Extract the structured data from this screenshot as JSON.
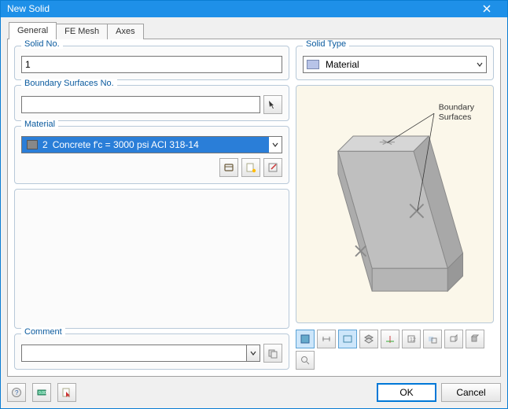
{
  "titlebar": {
    "title": "New Solid"
  },
  "tabs": {
    "general": "General",
    "femesh": "FE Mesh",
    "axes": "Axes",
    "active": "general"
  },
  "solidNo": {
    "label": "Solid No.",
    "value": "1"
  },
  "boundary": {
    "label": "Boundary Surfaces No.",
    "value": ""
  },
  "material": {
    "label": "Material",
    "index": "2",
    "text": "Concrete f'c = 3000 psi    ACI 318-14"
  },
  "comment": {
    "label": "Comment",
    "value": ""
  },
  "solidType": {
    "label": "Solid Type",
    "value": "Material"
  },
  "preview": {
    "annotation": "Boundary\nSurfaces"
  },
  "buttons": {
    "ok": "OK",
    "cancel": "Cancel"
  },
  "icons": {
    "boundary_picker": "pick-surfaces-icon",
    "mat_lib": "material-library-icon",
    "mat_new": "new-material-icon",
    "mat_edit": "edit-material-icon",
    "comment_recent": "recent-comments-icon",
    "help": "help-icon",
    "units": "units-icon",
    "pick_new": "pick-new-icon",
    "toolbar": [
      "view-reset-icon",
      "dimension-icon",
      "zoom-window-icon",
      "layers-icon",
      "local-axes-icon",
      "numbering-icon",
      "transparency-icon",
      "wireframe-icon",
      "shade-icon",
      "zoom-fit-icon"
    ]
  }
}
